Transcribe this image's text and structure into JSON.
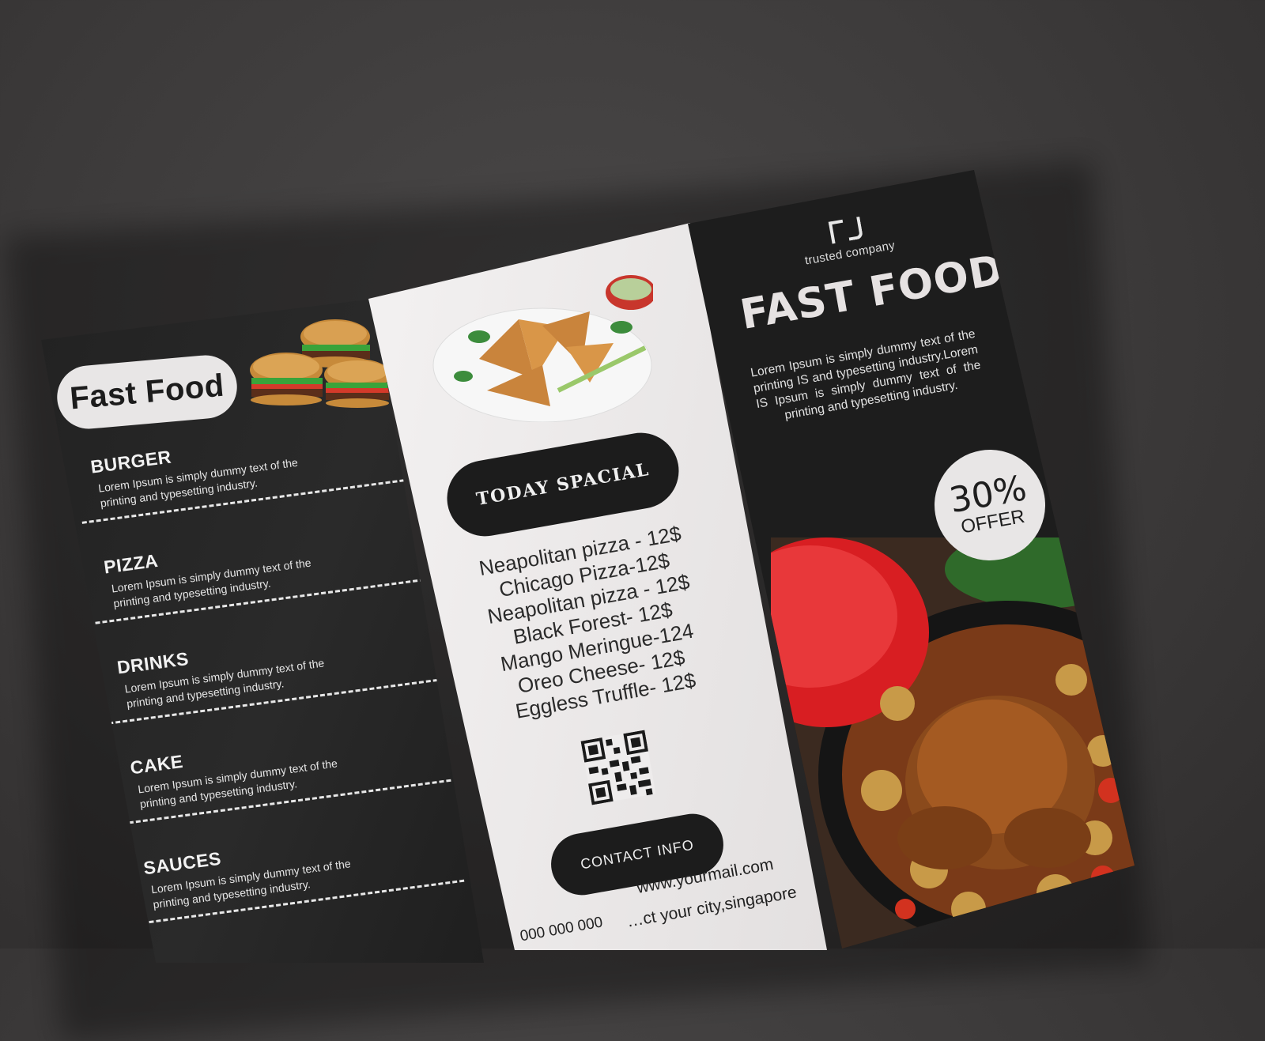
{
  "left_panel": {
    "title": "Fast Food",
    "items": [
      {
        "name": "BURGER",
        "desc": "Lorem Ipsum is simply dummy text of the printing and typesetting industry."
      },
      {
        "name": "PIZZA",
        "desc": "Lorem Ipsum is simply dummy text of the printing and typesetting industry."
      },
      {
        "name": "DRINKS",
        "desc": "Lorem Ipsum is simply dummy text of the printing and typesetting industry."
      },
      {
        "name": "CAKE",
        "desc": "Lorem Ipsum is simply dummy text of the printing and typesetting industry."
      },
      {
        "name": "SAUCES",
        "desc": "Lorem Ipsum is simply dummy text of the printing and typesetting industry."
      }
    ]
  },
  "middle_panel": {
    "special_label": "TODAY SPACIAL",
    "specials": [
      "Neapolitan pizza - 12$",
      "Chicago Pizza-12$",
      "Neapolitan pizza - 12$",
      "Black Forest- 12$",
      "Mango Meringue-124",
      "Oreo Cheese- 12$",
      "Eggless Truffle- 12$"
    ],
    "contact_label": "CONTACT INFO",
    "email": "www.yourmail.com",
    "phone": "000 000 000",
    "address": "…ct your city,singapore"
  },
  "right_panel": {
    "logo_tagline": "trusted company",
    "title": "FAST FOOD",
    "description": "Lorem Ipsum is simply dummy text of the printing IS and typesetting industry.Lorem IS Ipsum is simply dummy text of the printing and typesetting industry.",
    "offer_percent": "30%",
    "offer_label": "OFFER"
  },
  "colors": {
    "background": "#3c3a3a",
    "panel_dark": "#1d1d1d",
    "panel_light": "#eeecec",
    "pot_red": "#d81e22"
  }
}
